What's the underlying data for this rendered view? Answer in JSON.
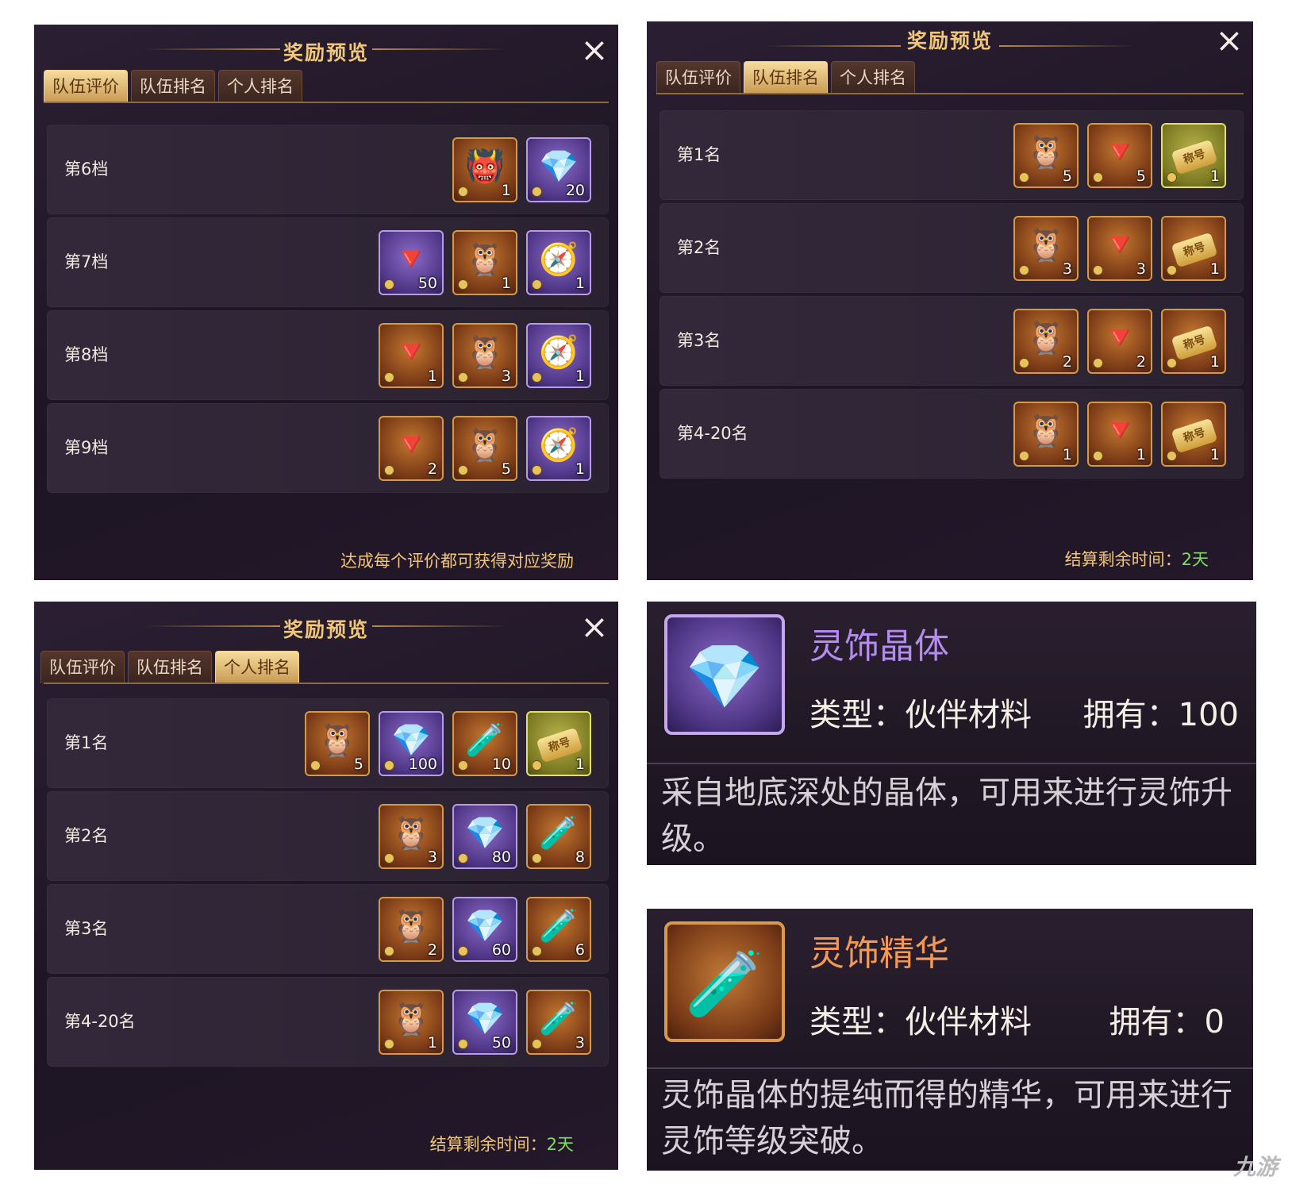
{
  "team_eval_panel": {
    "title": "奖励预览",
    "tabs": [
      "队伍评价",
      "队伍排名",
      "个人排名"
    ],
    "active_tab": 0,
    "rows": [
      {
        "label": "第6档",
        "items": [
          {
            "icon": "demon-chest-icon",
            "qty": "1",
            "frame": "orange"
          },
          {
            "icon": "spirit-crystal-icon",
            "qty": "20",
            "frame": "purple"
          }
        ]
      },
      {
        "label": "第7档",
        "items": [
          {
            "icon": "red-shard-icon",
            "qty": "50",
            "frame": "purple"
          },
          {
            "icon": "owl-chest-icon",
            "qty": "1",
            "frame": "orange"
          },
          {
            "icon": "compass-icon",
            "qty": "1",
            "frame": "purple"
          }
        ]
      },
      {
        "label": "第8档",
        "items": [
          {
            "icon": "red-shard-icon",
            "qty": "1",
            "frame": "orange"
          },
          {
            "icon": "owl-chest-icon",
            "qty": "3",
            "frame": "orange"
          },
          {
            "icon": "compass-icon",
            "qty": "1",
            "frame": "purple"
          }
        ]
      },
      {
        "label": "第9档",
        "items": [
          {
            "icon": "red-shard-icon",
            "qty": "2",
            "frame": "orange"
          },
          {
            "icon": "owl-chest-icon",
            "qty": "5",
            "frame": "orange"
          },
          {
            "icon": "compass-icon",
            "qty": "1",
            "frame": "purple"
          }
        ]
      }
    ],
    "footer": "达成每个评价都可获得对应奖励"
  },
  "team_rank_panel": {
    "title": "奖励预览",
    "tabs": [
      "队伍评价",
      "队伍排名",
      "个人排名"
    ],
    "active_tab": 1,
    "rows": [
      {
        "label": "第1名",
        "items": [
          {
            "icon": "owl-chest-icon",
            "qty": "5",
            "frame": "orange"
          },
          {
            "icon": "red-shard-icon",
            "qty": "5",
            "frame": "orange"
          },
          {
            "icon": "title-ticket-icon",
            "qty": "1",
            "frame": "green"
          }
        ]
      },
      {
        "label": "第2名",
        "items": [
          {
            "icon": "owl-chest-icon",
            "qty": "3",
            "frame": "orange"
          },
          {
            "icon": "red-shard-icon",
            "qty": "3",
            "frame": "orange"
          },
          {
            "icon": "title-ticket-icon",
            "qty": "1",
            "frame": "orange"
          }
        ]
      },
      {
        "label": "第3名",
        "items": [
          {
            "icon": "owl-chest-icon",
            "qty": "2",
            "frame": "orange"
          },
          {
            "icon": "red-shard-icon",
            "qty": "2",
            "frame": "orange"
          },
          {
            "icon": "title-ticket-icon",
            "qty": "1",
            "frame": "orange"
          }
        ]
      },
      {
        "label": "第4-20名",
        "items": [
          {
            "icon": "owl-chest-icon",
            "qty": "1",
            "frame": "orange"
          },
          {
            "icon": "red-shard-icon",
            "qty": "1",
            "frame": "orange"
          },
          {
            "icon": "title-ticket-icon",
            "qty": "1",
            "frame": "orange"
          }
        ]
      }
    ],
    "footer_label": "结算剩余时间：",
    "footer_value": "2天"
  },
  "personal_rank_panel": {
    "title": "奖励预览",
    "tabs": [
      "队伍评价",
      "队伍排名",
      "个人排名"
    ],
    "active_tab": 2,
    "rows": [
      {
        "label": "第1名",
        "items": [
          {
            "icon": "owl-chest-icon",
            "qty": "5",
            "frame": "orange"
          },
          {
            "icon": "spirit-crystal-icon",
            "qty": "100",
            "frame": "purple"
          },
          {
            "icon": "essence-bottle-icon",
            "qty": "10",
            "frame": "orange"
          },
          {
            "icon": "title-ticket-icon",
            "qty": "1",
            "frame": "green"
          }
        ]
      },
      {
        "label": "第2名",
        "items": [
          {
            "icon": "owl-chest-icon",
            "qty": "3",
            "frame": "orange"
          },
          {
            "icon": "spirit-crystal-icon",
            "qty": "80",
            "frame": "purple"
          },
          {
            "icon": "essence-bottle-icon",
            "qty": "8",
            "frame": "orange"
          }
        ]
      },
      {
        "label": "第3名",
        "items": [
          {
            "icon": "owl-chest-icon",
            "qty": "2",
            "frame": "orange"
          },
          {
            "icon": "spirit-crystal-icon",
            "qty": "60",
            "frame": "purple"
          },
          {
            "icon": "essence-bottle-icon",
            "qty": "6",
            "frame": "orange"
          }
        ]
      },
      {
        "label": "第4-20名",
        "items": [
          {
            "icon": "owl-chest-icon",
            "qty": "1",
            "frame": "orange"
          },
          {
            "icon": "spirit-crystal-icon",
            "qty": "50",
            "frame": "purple"
          },
          {
            "icon": "essence-bottle-icon",
            "qty": "3",
            "frame": "orange"
          }
        ]
      }
    ],
    "footer_label": "结算剩余时间：",
    "footer_value": "2天"
  },
  "tooltip_crystal": {
    "name": "灵饰晶体",
    "name_color": "#b48cf0",
    "type": "类型：伙伴材料",
    "own": "拥有：100",
    "desc": "采自地底深处的晶体，可用来进行灵饰升级。"
  },
  "tooltip_essence": {
    "name": "灵饰精华",
    "name_color": "#f29a55",
    "type": "类型：伙伴材料",
    "own": "拥有：0",
    "desc": "灵饰晶体的提纯而得的精华，可用来进行灵饰等级突破。"
  },
  "ticket_text": "称号",
  "watermark": "九游"
}
